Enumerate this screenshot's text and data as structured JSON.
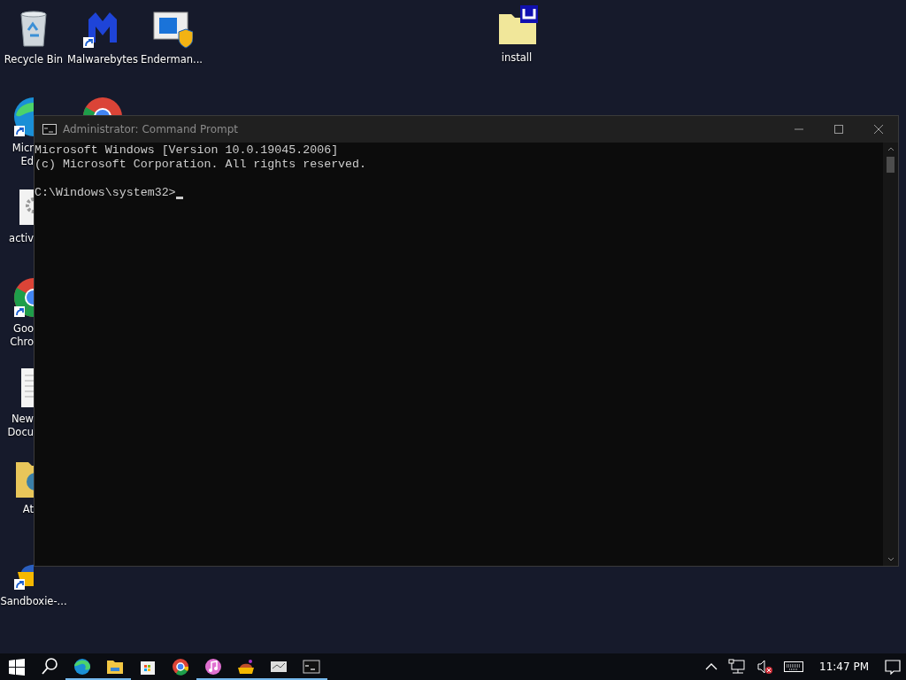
{
  "desktop_icons": [
    {
      "kind": "recycle-bin",
      "label_lines": [
        "Recycle Bin"
      ],
      "shortcut": false,
      "cut": false
    },
    {
      "kind": "malwarebytes",
      "label_lines": [
        "Malwarebytes"
      ],
      "shortcut": true,
      "cut": false
    },
    {
      "kind": "settings-window",
      "label_lines": [
        "Enderman..."
      ],
      "shortcut": false,
      "cut": false
    },
    {
      "kind": "folder-app",
      "label_lines": [
        "install"
      ],
      "shortcut": false,
      "cut": false
    },
    {
      "kind": "edge",
      "label_lines": [
        "Micr",
        "Ed"
      ],
      "shortcut": true,
      "cut": true
    },
    {
      "kind": "chrome",
      "shortcut": false
    },
    {
      "kind": "gear-file",
      "label_lines": [
        "activ"
      ],
      "shortcut": false,
      "cut": true
    },
    {
      "kind": "chrome",
      "label_lines": [
        "Goo",
        "Chro"
      ],
      "shortcut": true,
      "cut": true
    },
    {
      "kind": "document",
      "label_lines": [
        "New",
        "Docu"
      ],
      "shortcut": false,
      "cut": true
    },
    {
      "kind": "folder",
      "label_lines": [
        "At"
      ],
      "shortcut": false,
      "cut": true
    },
    {
      "kind": "sandboxie",
      "label_lines": [
        "Sandboxie-..."
      ],
      "shortcut": true,
      "cut": false
    }
  ],
  "window": {
    "title": "Administrator: Command Prompt",
    "active": false,
    "console_blocks": [
      [
        "Microsoft Windows [Version 10.0.19045.2006]",
        "(c) Microsoft Corporation. All rights reserved."
      ],
      [
        "C:\\Windows\\system32>"
      ]
    ],
    "cursor": true
  },
  "taskbar": {
    "items": [
      {
        "kind": "start",
        "running": false
      },
      {
        "kind": "search",
        "running": false
      },
      {
        "kind": "edge",
        "running": true
      },
      {
        "kind": "explorer",
        "running": true
      },
      {
        "kind": "store",
        "running": false
      },
      {
        "kind": "chrome",
        "running": false
      },
      {
        "kind": "itunes",
        "running": true
      },
      {
        "kind": "sandboxie",
        "running": true
      },
      {
        "kind": "screen",
        "running": true
      },
      {
        "kind": "cmd",
        "running": true
      }
    ],
    "tray": {
      "time": "11:47 PM",
      "muted": true
    }
  }
}
